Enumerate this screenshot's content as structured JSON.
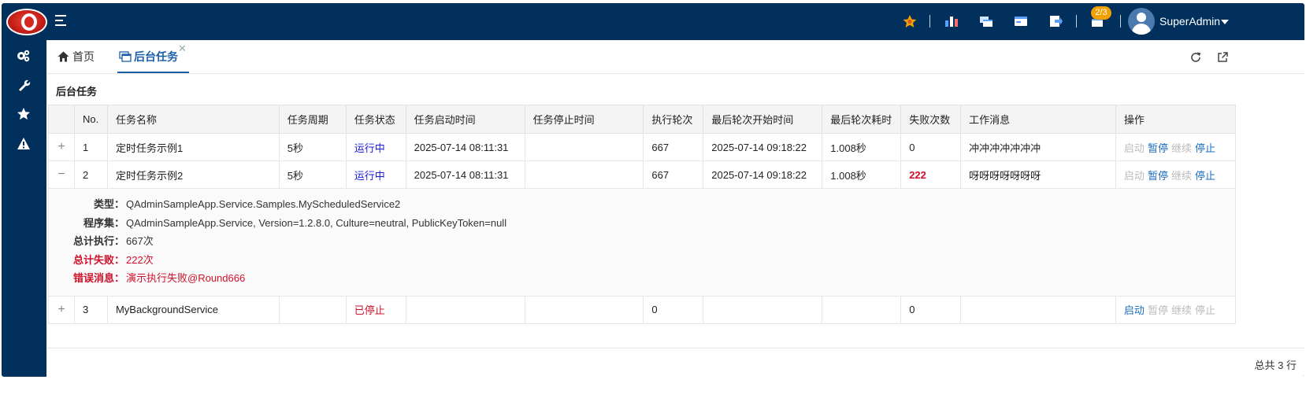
{
  "header": {
    "username": "SuperAdmin",
    "notification_badge": "2/3",
    "icons": [
      "medal-icon",
      "chart-icon",
      "windows-icon",
      "card-icon",
      "export-icon",
      "tasks-icon"
    ]
  },
  "sidebar": {
    "icons": [
      "cogs-icon",
      "wrench-icon",
      "star-icon",
      "warning-icon"
    ]
  },
  "tabs": [
    {
      "label": "首页",
      "icon": "home-icon"
    },
    {
      "label": "后台任务",
      "icon": "tasks-icon",
      "active": true
    }
  ],
  "panel": {
    "title": "后台任务"
  },
  "table": {
    "headers": [
      "No.",
      "任务名称",
      "任务周期",
      "任务状态",
      "任务启动时间",
      "任务停止时间",
      "执行轮次",
      "最后轮次开始时间",
      "最后轮次耗时",
      "失败次数",
      "工作消息",
      "操作"
    ],
    "rows": [
      {
        "expand": "+",
        "no": "1",
        "name": "定时任务示例1",
        "period": "5秒",
        "status": "运行中",
        "start": "2025-07-14 08:11:31",
        "stop": "",
        "rounds": "667",
        "last_start": "2025-07-14 09:18:22",
        "last_cost": "1.008秒",
        "fails": "0",
        "message": "冲冲冲冲冲冲冲"
      },
      {
        "expand": "−",
        "no": "2",
        "name": "定时任务示例2",
        "period": "5秒",
        "status": "运行中",
        "start": "2025-07-14 08:11:31",
        "stop": "",
        "rounds": "667",
        "last_start": "2025-07-14 09:18:22",
        "last_cost": "1.008秒",
        "fails": "222",
        "message": "呀呀呀呀呀呀呀"
      },
      {
        "expand": "+",
        "no": "3",
        "name": "MyBackgroundService",
        "period": "",
        "status": "已停止",
        "start": "",
        "stop": "",
        "rounds": "0",
        "last_start": "",
        "last_cost": "",
        "fails": "0",
        "message": ""
      }
    ],
    "ops": [
      "启动",
      "暂停",
      "继续",
      "停止"
    ],
    "detail": {
      "type_label": "类型：",
      "type_value": "QAdminSampleApp.Service.Samples.MyScheduledService2",
      "assembly_label": "程序集：",
      "assembly_value": "QAdminSampleApp.Service, Version=1.2.8.0, Culture=neutral, PublicKeyToken=null",
      "total_exec_label": "总计执行：",
      "total_exec_value": "667次",
      "total_fail_label": "总计失败：",
      "total_fail_value": "222次",
      "error_label": "错误消息：",
      "error_value": "演示执行失败@Round666"
    }
  },
  "footer": {
    "total": "总共 3 行"
  },
  "colors": {
    "header_bg": "#00305b",
    "accent": "#1a5fa8",
    "red": "#d0102a",
    "running": "#1a1adc"
  }
}
